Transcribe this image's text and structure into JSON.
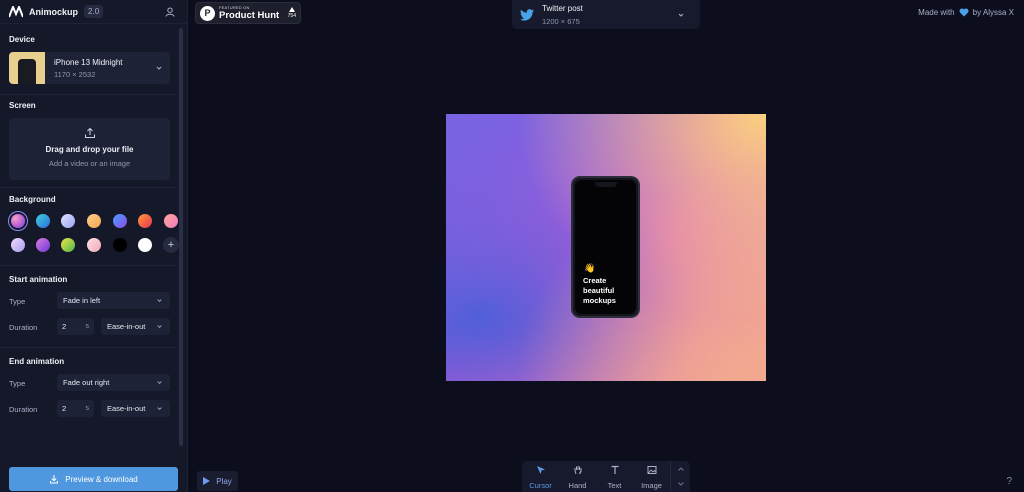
{
  "app": {
    "name": "Animockup",
    "version": "2.0"
  },
  "sidebar": {
    "device": {
      "title": "Device",
      "name": "iPhone 13 Midnight",
      "resolution": "1170 × 2532"
    },
    "screen": {
      "title": "Screen",
      "drop_title": "Drag and drop your file",
      "drop_subtitle": "Add a video or an image"
    },
    "background": {
      "title": "Background",
      "swatches": [
        {
          "name": "purple-pink",
          "selected": true
        },
        {
          "name": "cyan-blue"
        },
        {
          "name": "lavender"
        },
        {
          "name": "orange"
        },
        {
          "name": "blue-violet"
        },
        {
          "name": "red-orange"
        },
        {
          "name": "pink"
        },
        {
          "name": "lilac"
        },
        {
          "name": "purple"
        },
        {
          "name": "green-yellow"
        },
        {
          "name": "light-pink"
        },
        {
          "name": "black"
        },
        {
          "name": "white"
        }
      ],
      "add_label": "+"
    },
    "start_animation": {
      "title": "Start animation",
      "type_label": "Type",
      "type_value": "Fade in left",
      "duration_label": "Duration",
      "duration_value": "2",
      "duration_unit": "s",
      "easing_value": "Ease-in-out"
    },
    "end_animation": {
      "title": "End animation",
      "type_label": "Type",
      "type_value": "Fade out right",
      "duration_label": "Duration",
      "duration_value": "2",
      "duration_unit": "s",
      "easing_value": "Ease-in-out"
    },
    "preview_button": "Preview & download"
  },
  "product_hunt": {
    "featured": "FEATURED ON",
    "name": "Product Hunt",
    "votes": "754"
  },
  "format": {
    "name": "Twitter post",
    "resolution": "1200 × 675"
  },
  "credit": {
    "prefix": "Made with",
    "suffix": "by Alyssa X"
  },
  "canvas": {
    "emoji": "👋",
    "text": "Create beautiful mockups"
  },
  "play_button": "Play",
  "toolbar": {
    "tools": [
      "Cursor",
      "Hand",
      "Text",
      "Image"
    ],
    "active": "Cursor"
  },
  "help": "?",
  "colors": {
    "accent": "#4f98e0",
    "sidebar_bg": "#151829",
    "page_bg": "#0c0e1d"
  }
}
